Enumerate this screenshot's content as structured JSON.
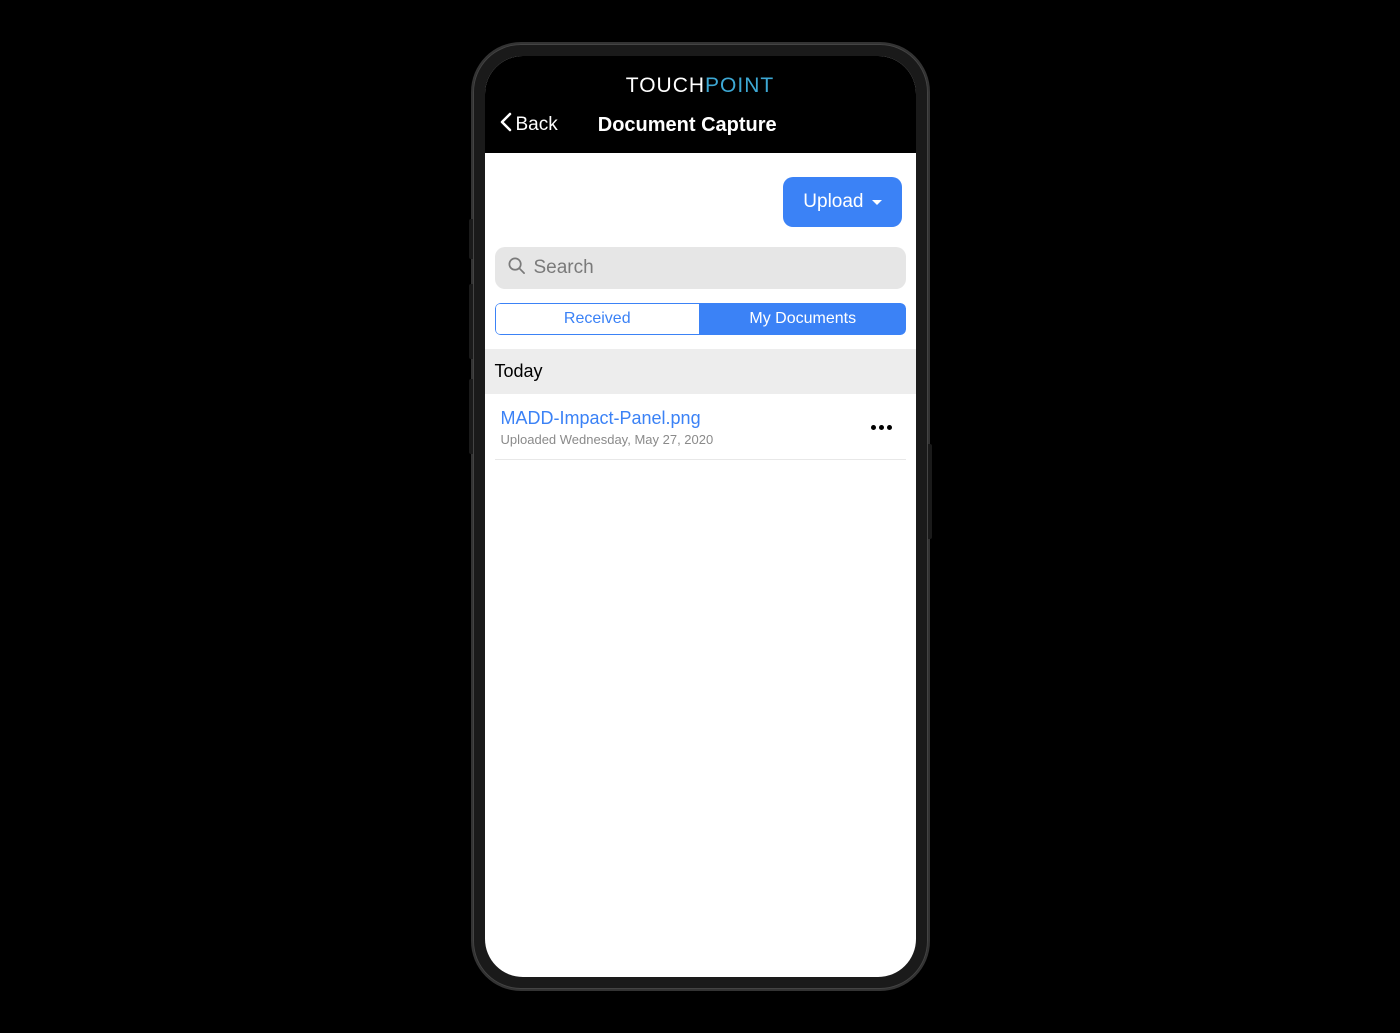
{
  "app": {
    "logo_part1": "TOUCH",
    "logo_part2": "POINT"
  },
  "nav": {
    "back_label": "Back",
    "page_title": "Document Capture"
  },
  "upload": {
    "label": "Upload"
  },
  "search": {
    "placeholder": "Search"
  },
  "tabs": {
    "received": "Received",
    "my_documents": "My Documents",
    "active": "my_documents"
  },
  "sections": [
    {
      "label": "Today",
      "documents": [
        {
          "name": "MADD-Impact-Panel.png",
          "meta": "Uploaded Wednesday, May 27, 2020"
        }
      ]
    }
  ]
}
